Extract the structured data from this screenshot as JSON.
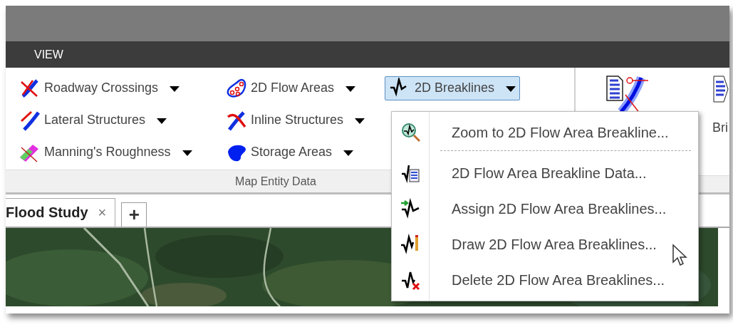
{
  "ribbon_tabs": [
    {
      "label": "VIEW",
      "selected": true
    }
  ],
  "ribbon": {
    "groups": [
      {
        "label": "Map Entity Data",
        "buttons": [
          {
            "label": "Roadway Crossings",
            "selected": false
          },
          {
            "label": "Lateral Structures",
            "selected": false
          },
          {
            "label": "Manning's Roughness",
            "selected": false
          },
          {
            "label": "2D Flow Areas",
            "selected": false
          },
          {
            "label": "Inline Structures",
            "selected": false
          },
          {
            "label": "Storage Areas",
            "selected": false
          },
          {
            "label": "2D Breaklines",
            "selected": true
          }
        ]
      },
      {
        "kind": "large_buttons",
        "last_button_label": "Bri"
      }
    ]
  },
  "dropdown_menu": {
    "items": [
      {
        "label": "Zoom to 2D Flow Area Breakline...",
        "separator_after": true
      },
      {
        "label": "2D Flow Area Breakline Data...",
        "separator_after": false
      },
      {
        "label": "Assign 2D Flow Area Breaklines...",
        "separator_after": false
      },
      {
        "label": "Draw 2D Flow Area Breaklines...",
        "separator_after": false
      },
      {
        "label": "Delete 2D Flow Area Breaklines...",
        "separator_after": false
      }
    ]
  },
  "document_tabs": [
    {
      "label": "Flood Study",
      "close": "×",
      "selected": true
    }
  ],
  "new_tab_button": "+"
}
